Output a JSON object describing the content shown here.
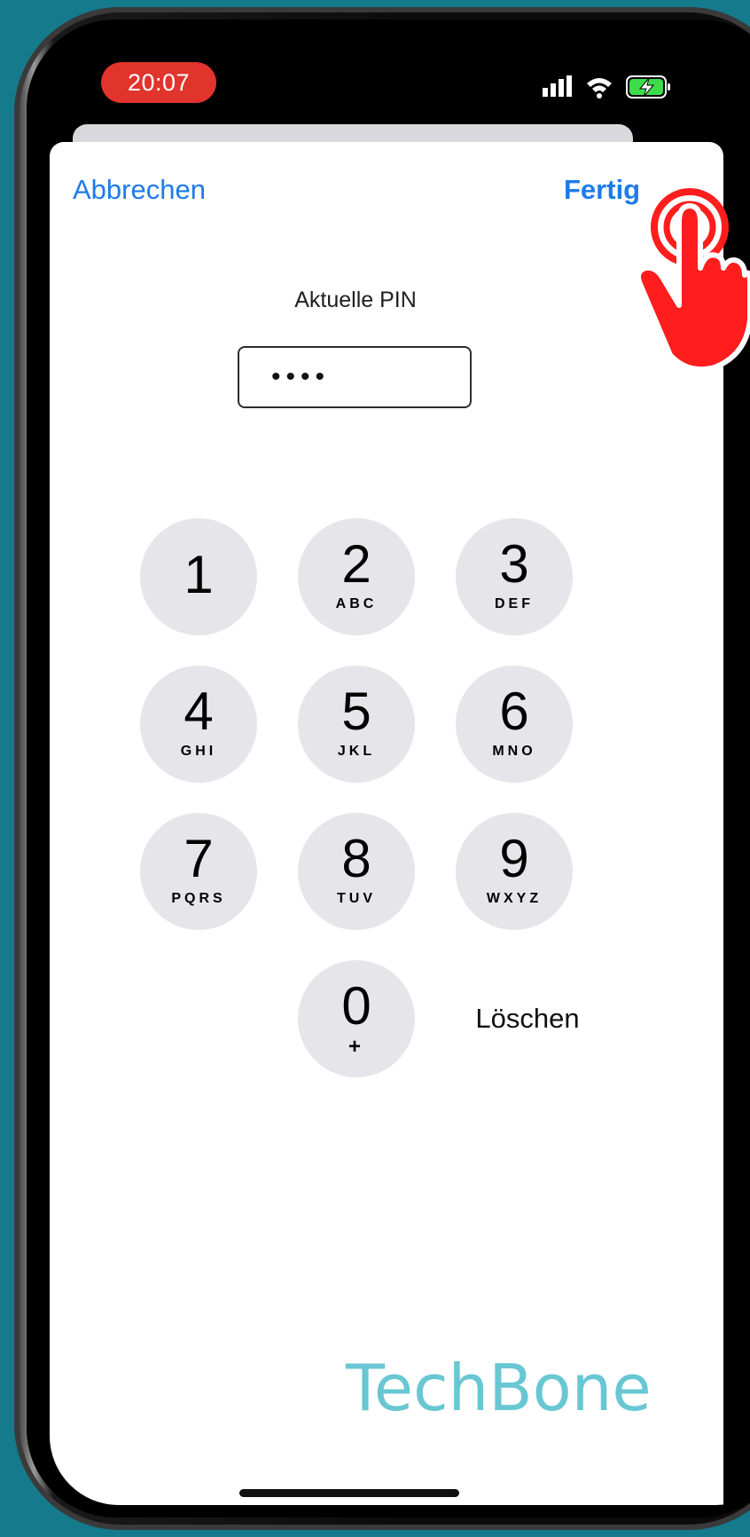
{
  "status_bar": {
    "time": "20:07"
  },
  "nav": {
    "cancel_label": "Abbrechen",
    "done_label": "Fertig"
  },
  "pin": {
    "label": "Aktuelle PIN",
    "masked_value": "••••"
  },
  "keypad": {
    "keys": [
      {
        "digit": "1",
        "letters": ""
      },
      {
        "digit": "2",
        "letters": "ABC"
      },
      {
        "digit": "3",
        "letters": "DEF"
      },
      {
        "digit": "4",
        "letters": "GHI"
      },
      {
        "digit": "5",
        "letters": "JKL"
      },
      {
        "digit": "6",
        "letters": "MNO"
      },
      {
        "digit": "7",
        "letters": "PQRS"
      },
      {
        "digit": "8",
        "letters": "TUV"
      },
      {
        "digit": "9",
        "letters": "WXYZ"
      },
      {
        "digit": "0",
        "letters": "+"
      }
    ],
    "delete_label": "Löschen"
  },
  "watermark": {
    "text": "TechBone"
  },
  "colors": {
    "accent": "#1d7bea",
    "time_pill": "#e0342c",
    "key_background": "#e5e5ea",
    "watermark": "#58c1cf",
    "tap_indicator": "#ff1d1d"
  }
}
